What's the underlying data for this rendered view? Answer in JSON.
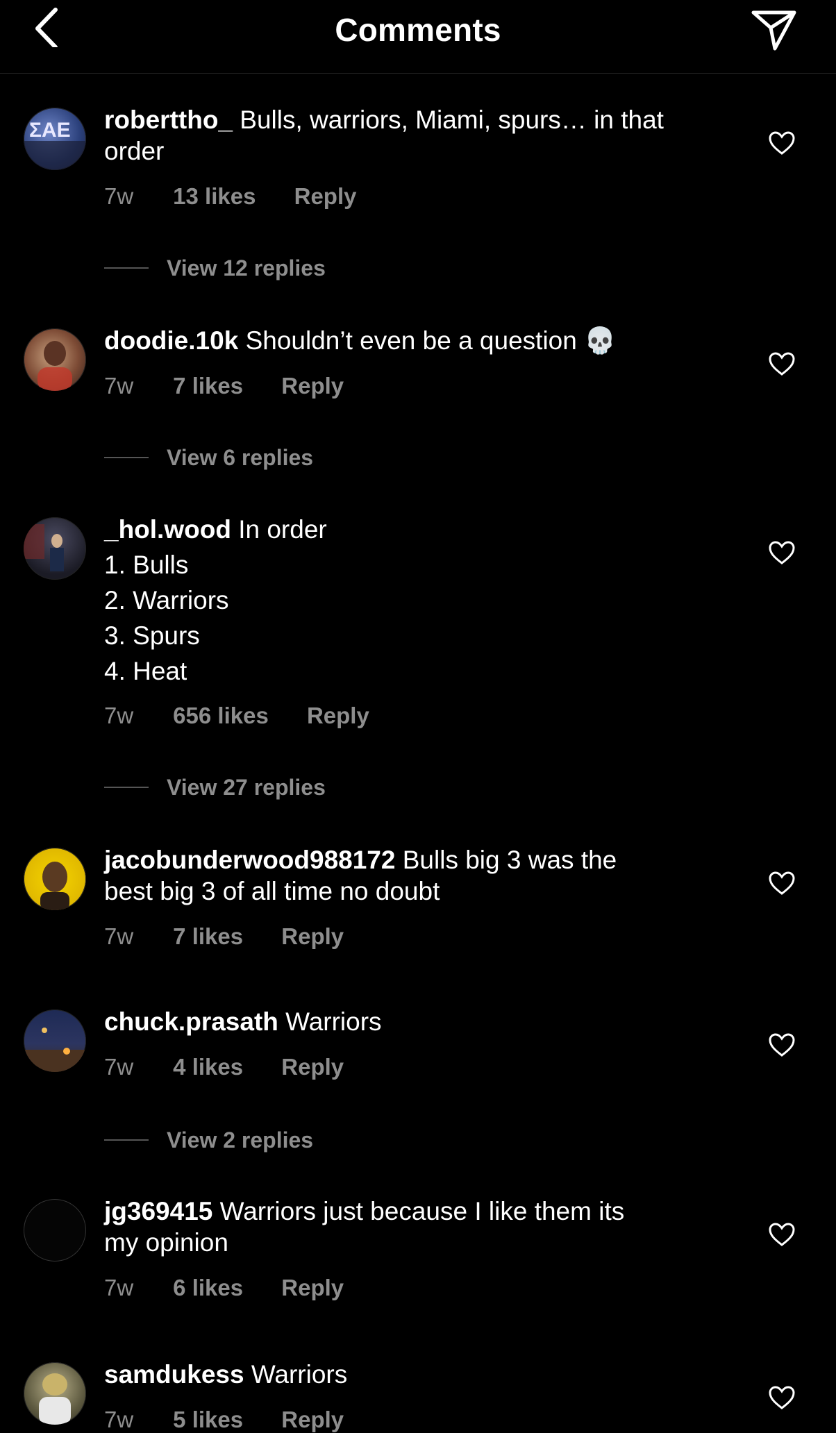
{
  "header": {
    "title": "Comments"
  },
  "comments": [
    {
      "username": "roberttho_",
      "text_lines": [
        "Bulls, warriors, Miami, spurs… in that",
        "order"
      ],
      "time": "7w",
      "likes": "13 likes",
      "reply": "Reply",
      "view_replies": "View 12 replies"
    },
    {
      "username": "doodie.10k",
      "text_lines": [
        "Shouldn’t even be a question 💀"
      ],
      "time": "7w",
      "likes": "7 likes",
      "reply": "Reply",
      "view_replies": "View 6 replies"
    },
    {
      "username": "_hol.wood",
      "text_lines": [
        "In order",
        "1. Bulls",
        "2. Warriors",
        "3. Spurs",
        "4. Heat"
      ],
      "time": "7w",
      "likes": "656 likes",
      "reply": "Reply",
      "view_replies": "View 27 replies"
    },
    {
      "username": "jacobunderwood988172",
      "text_lines": [
        "Bulls big 3 was the",
        "best big 3 of all time no doubt"
      ],
      "time": "7w",
      "likes": "7 likes",
      "reply": "Reply"
    },
    {
      "username": "chuck.prasath",
      "text_lines": [
        "Warriors"
      ],
      "time": "7w",
      "likes": "4 likes",
      "reply": "Reply",
      "view_replies": "View 2 replies"
    },
    {
      "username": "jg369415",
      "text_lines": [
        "Warriors just because I like them its",
        "my opinion"
      ],
      "time": "7w",
      "likes": "6 likes",
      "reply": "Reply"
    },
    {
      "username": "samdukess",
      "text_lines": [
        "Warriors"
      ],
      "time": "7w",
      "likes": "5 likes",
      "reply": "Reply"
    }
  ],
  "icons": {
    "back": "chevron-left-icon",
    "share": "send-icon",
    "like": "heart-icon"
  },
  "colors": {
    "background": "#000000",
    "text": "#ffffff",
    "secondary_text": "#8e8e8e"
  }
}
